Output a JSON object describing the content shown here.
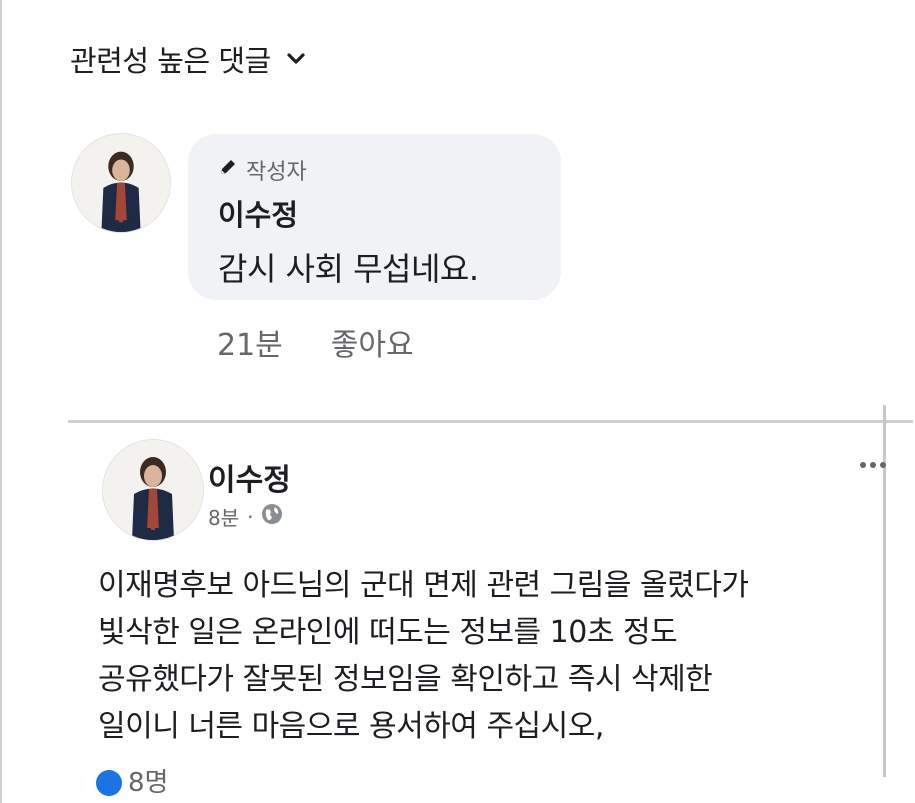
{
  "sort": {
    "label": "관련성 높은 댓글",
    "icon": "chevron-down-icon"
  },
  "comment": {
    "badge_label": "작성자",
    "author": "이수정",
    "text": "감시 사회 무섭네요.",
    "time": "21분",
    "like_label": "좋아요"
  },
  "post": {
    "author": "이수정",
    "time": "8분",
    "separator": "·",
    "privacy_icon": "globe-icon",
    "body_lines": [
      "이재명후보 아드님의 군대 면제 관련 그림을 올렸다가",
      "빛삭한 일은 온라인에 떠도는 정보를 10초 정도",
      "공유했다가 잘못된 정보임을 확인하고 즉시 삭제한",
      "일이니 너른 마음으로 용서하여 주십시오,"
    ],
    "reaction_count": "8명"
  },
  "colors": {
    "bubble": "#f0f2f5",
    "meta": "#65676b",
    "like": "#1b74e4"
  }
}
